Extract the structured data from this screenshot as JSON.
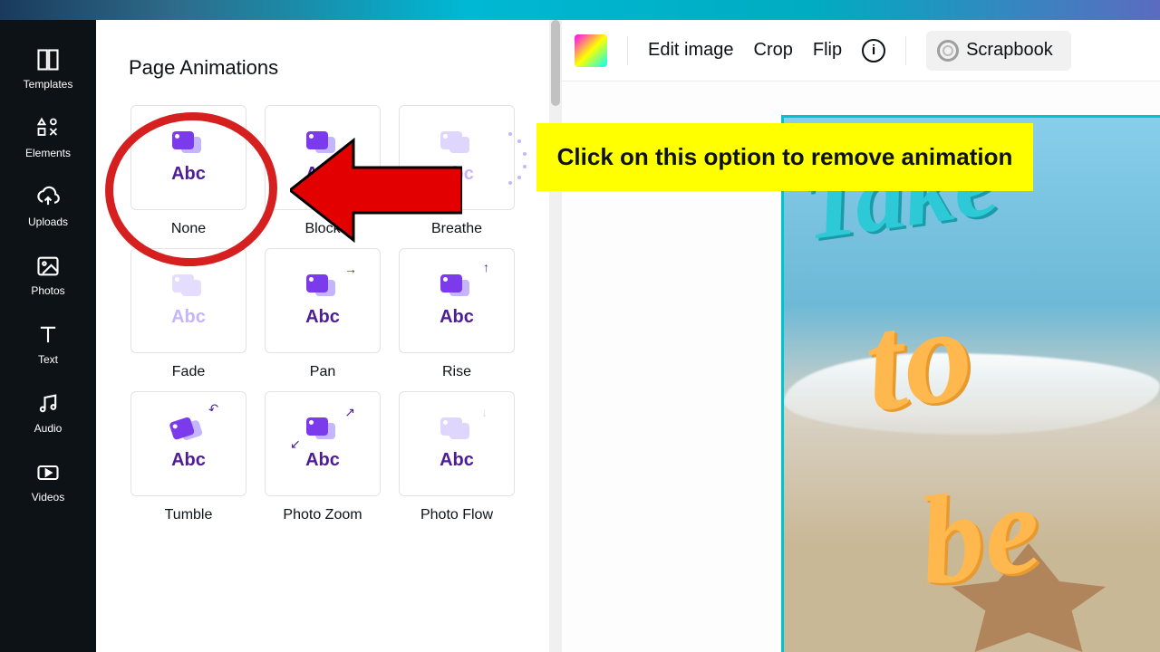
{
  "sidebar": {
    "items": [
      {
        "label": "Templates",
        "icon": "templates"
      },
      {
        "label": "Elements",
        "icon": "elements"
      },
      {
        "label": "Uploads",
        "icon": "uploads"
      },
      {
        "label": "Photos",
        "icon": "photos"
      },
      {
        "label": "Text",
        "icon": "text"
      },
      {
        "label": "Audio",
        "icon": "audio"
      },
      {
        "label": "Videos",
        "icon": "videos"
      }
    ]
  },
  "panel": {
    "title": "Page Animations",
    "options": [
      {
        "label": "None"
      },
      {
        "label": "Block"
      },
      {
        "label": "Breathe"
      },
      {
        "label": "Fade"
      },
      {
        "label": "Pan"
      },
      {
        "label": "Rise"
      },
      {
        "label": "Tumble"
      },
      {
        "label": "Photo Zoom"
      },
      {
        "label": "Photo Flow"
      }
    ],
    "abc": "Abc"
  },
  "toolbar": {
    "edit_image": "Edit image",
    "crop": "Crop",
    "flip": "Flip",
    "scrapbook": "Scrapbook"
  },
  "design": {
    "text1": "Take",
    "text2": "to",
    "text3": "be"
  },
  "callout": {
    "text": "Click on this option to remove animation"
  }
}
